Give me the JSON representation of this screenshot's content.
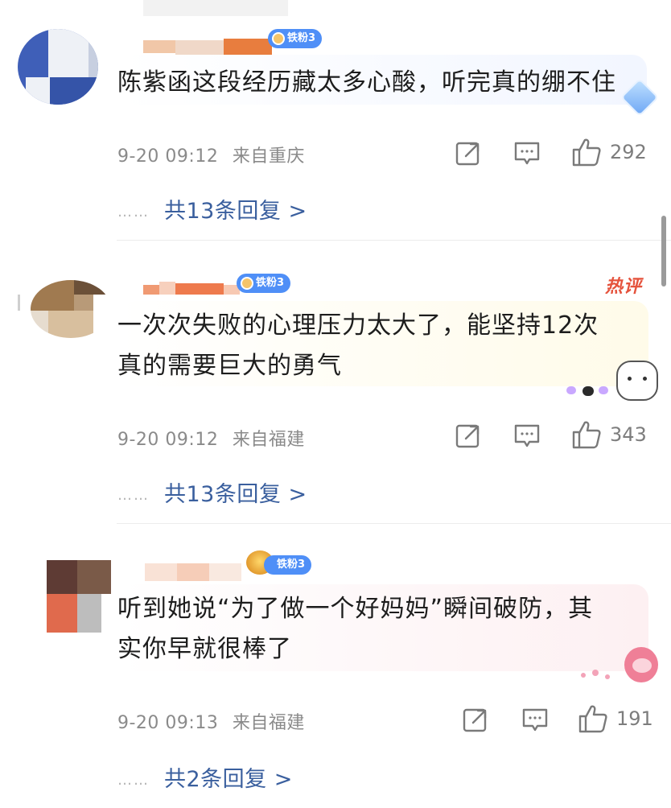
{
  "comments": [
    {
      "badge": "铁粉3",
      "text": "陈紫函这段经历藏太多心酸，听完真的绷不住",
      "date": "9-20 09:12",
      "location": "来自重庆",
      "likes": "292",
      "replies": "共13条回复 >",
      "dots": "……"
    },
    {
      "badge": "铁粉3",
      "hot": "热评",
      "text": "一次次失败的心理压力太大了，能坚持12次\n真的需要巨大的勇气",
      "date": "9-20 09:12",
      "location": "来自福建",
      "likes": "343",
      "replies": "共13条回复 >",
      "dots": "……"
    },
    {
      "badge": "铁粉3",
      "text": "听到她说“为了做一个好妈妈”瞬间破防，其\n实你早就很棒了",
      "date": "9-20 09:13",
      "location": "来自福建",
      "likes": "191",
      "replies": "共2条回复 >",
      "dots": "……"
    }
  ],
  "icons": {
    "share": "share-icon",
    "comment": "comment-icon",
    "like": "thumbs-up-icon"
  },
  "colors": {
    "badge": "#4f8ff7",
    "reply_link": "#3a5f9e",
    "meta": "#8a8a8a",
    "hot": "#e5533d"
  }
}
